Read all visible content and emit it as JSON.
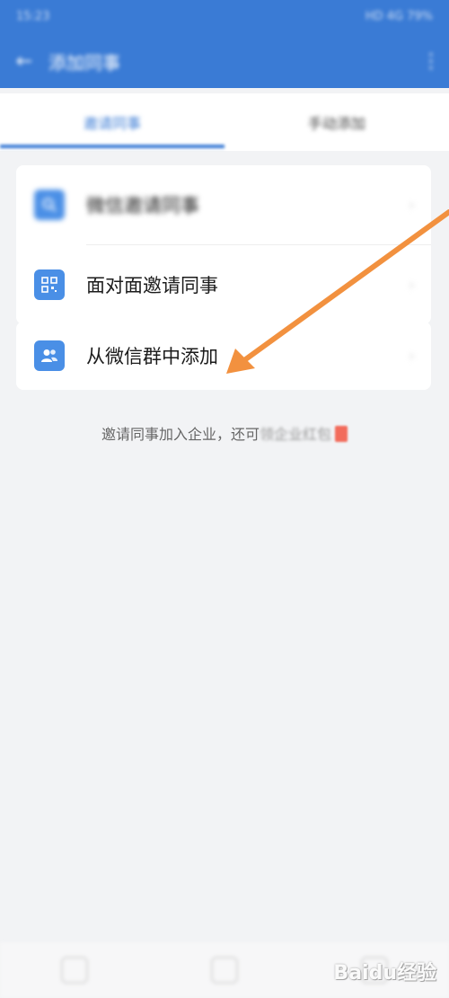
{
  "status_bar": {
    "time": "15:23",
    "icons": "HD 4G 79%"
  },
  "header": {
    "back_label": "←",
    "title": "添加同事",
    "more_label": "⋮"
  },
  "tabs": [
    {
      "label": "邀请同事"
    },
    {
      "label": "手动添加"
    }
  ],
  "list_top": [
    {
      "icon": "search-icon",
      "label": "微信邀请同事",
      "chevron": "›"
    },
    {
      "icon": "qr-code-icon",
      "label": "面对面邀请同事",
      "chevron": "›"
    }
  ],
  "list_bottom": [
    {
      "icon": "group-icon",
      "label": "从微信群中添加",
      "chevron": "›"
    }
  ],
  "hint": {
    "text": "邀请同事加入企业，还可",
    "tail": "领企业红包"
  },
  "watermark": "Baidu经验",
  "colors": {
    "primary": "#3a7bd5",
    "annotation_arrow": "#f2913f"
  }
}
